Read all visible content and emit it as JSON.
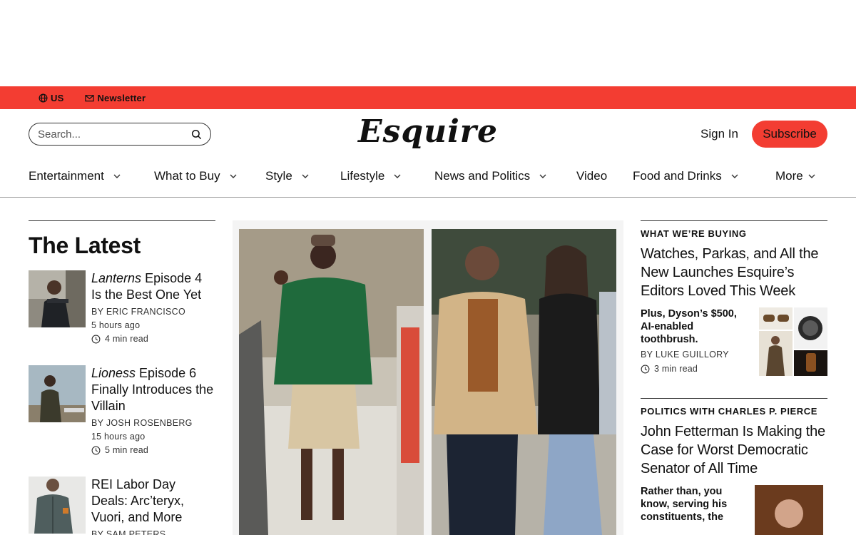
{
  "topbar": {
    "region": "US",
    "newsletter": "Newsletter"
  },
  "header": {
    "search_placeholder": "Search...",
    "logo_alt": "Esquire",
    "signin": "Sign In",
    "subscribe": "Subscribe"
  },
  "nav": {
    "items": [
      {
        "label": "Entertainment"
      },
      {
        "label": "What to Buy"
      },
      {
        "label": "Style"
      },
      {
        "label": "Lifestyle"
      },
      {
        "label": "News and Politics"
      },
      {
        "label": "Video"
      },
      {
        "label": "Food and Drinks"
      },
      {
        "label": "More"
      }
    ]
  },
  "latest": {
    "heading": "The Latest",
    "stories": [
      {
        "title_em": "Lanterns",
        "title_rest": " Episode 4 Is the Best One Yet",
        "byline": "BY ERIC FRANCISCO",
        "time": "5 hours ago",
        "read": "4 min read"
      },
      {
        "title_em": "Lioness",
        "title_rest": " Episode 6 Finally Introduces the Villain",
        "byline": "BY JOSH ROSENBERG",
        "time": "15 hours ago",
        "read": "5 min read"
      },
      {
        "title_em": "",
        "title_rest": "REI Labor Day Deals: Arc’teryx, Vuori, and More",
        "byline": "BY SAM PETERS"
      }
    ]
  },
  "right": {
    "block1": {
      "kicker": "WHAT WE’RE BUYING",
      "title": "Watches, Parkas, and All the New Launches Esquire’s Editors Loved This Week",
      "dek": "Plus, Dyson’s $500, AI-enabled toothbrush.",
      "byline": "BY LUKE GUILLORY",
      "read": "3 min read"
    },
    "block2": {
      "kicker": "POLITICS WITH CHARLES P. PIERCE",
      "title": "John Fetterman Is Making the Case for Worst Democratic Senator of All Time",
      "dek": "Rather than, you know, serving his constituents, the"
    }
  },
  "colors": {
    "brand_red": "#f33d32"
  }
}
